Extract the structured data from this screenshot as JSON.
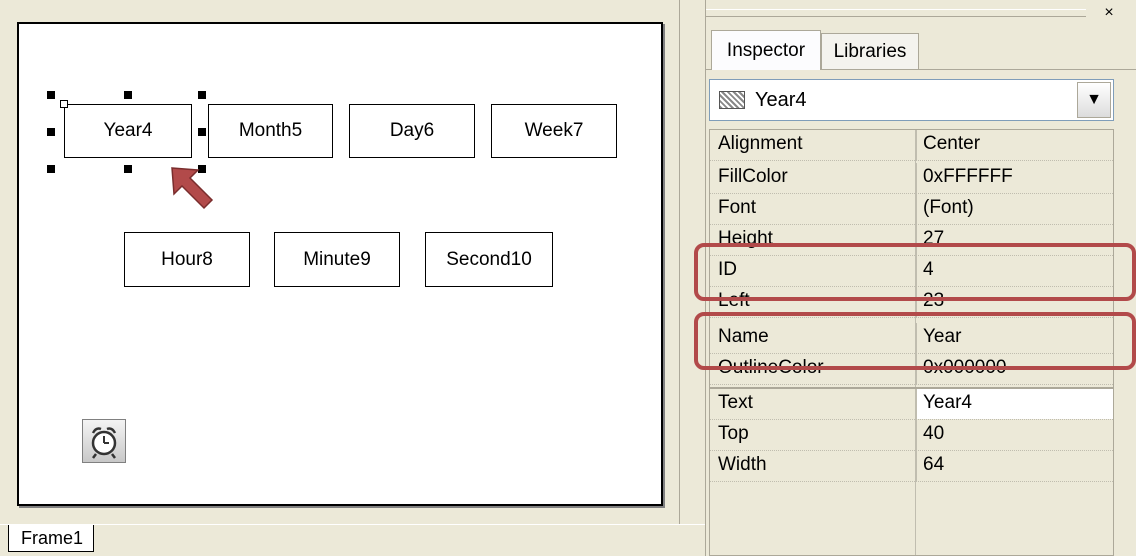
{
  "form": {
    "controls": {
      "year": "Year4",
      "month": "Month5",
      "day": "Day6",
      "week": "Week7",
      "hour": "Hour8",
      "minute": "Minute9",
      "second": "Second10"
    },
    "timer_icon": "alarm-clock-icon"
  },
  "bottom_tabs": [
    "Frame1"
  ],
  "panel": {
    "close_label": "×",
    "tabs": [
      "Inspector",
      "Libraries"
    ],
    "selected_object": "Year4",
    "properties": [
      {
        "name": "Alignment",
        "value": "Center"
      },
      {
        "name": "FillColor",
        "value": "0xFFFFFF"
      },
      {
        "name": "Font",
        "value": "(Font)"
      },
      {
        "name": "Height",
        "value": "27"
      },
      {
        "name": "ID",
        "value": "4"
      },
      {
        "name": "Left",
        "value": "23"
      },
      {
        "name": "Name",
        "value": "Year"
      },
      {
        "name": "OutlineColor",
        "value": "0x000000"
      },
      {
        "name": "Text",
        "value": "Year4"
      },
      {
        "name": "Top",
        "value": "40"
      },
      {
        "name": "Width",
        "value": "64"
      }
    ]
  },
  "colors": {
    "highlight": "#b24a4a",
    "panel_bg": "#ece9d8"
  }
}
